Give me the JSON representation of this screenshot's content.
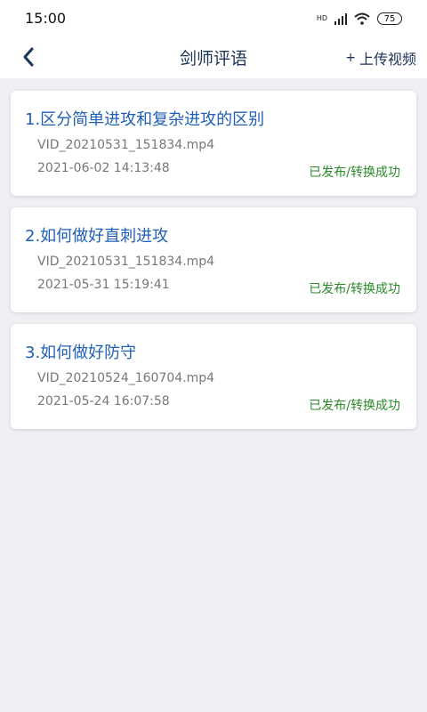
{
  "status_bar": {
    "time": "15:00",
    "network": "HD",
    "battery": "75"
  },
  "header": {
    "title": "剑师评语",
    "upload_label": "上传视频"
  },
  "items": [
    {
      "title": "1.区分简单进攻和复杂进攻的区别",
      "file": "VID_20210531_151834.mp4",
      "date": "2021-06-02 14:13:48",
      "status": "已发布/转换成功"
    },
    {
      "title": "2.如何做好直刺进攻",
      "file": "VID_20210531_151834.mp4",
      "date": "2021-05-31 15:19:41",
      "status": "已发布/转换成功"
    },
    {
      "title": "3.如何做好防守",
      "file": "VID_20210524_160704.mp4",
      "date": "2021-05-24 16:07:58",
      "status": "已发布/转换成功"
    }
  ],
  "icons": {
    "back": "chevron-left-icon",
    "upload": "plus-icon",
    "signal": "signal-icon",
    "wifi": "wifi-icon"
  },
  "colors": {
    "title_blue": "#1f5fb6",
    "status_green": "#2a8a2a",
    "nav_text": "#1b3357"
  }
}
